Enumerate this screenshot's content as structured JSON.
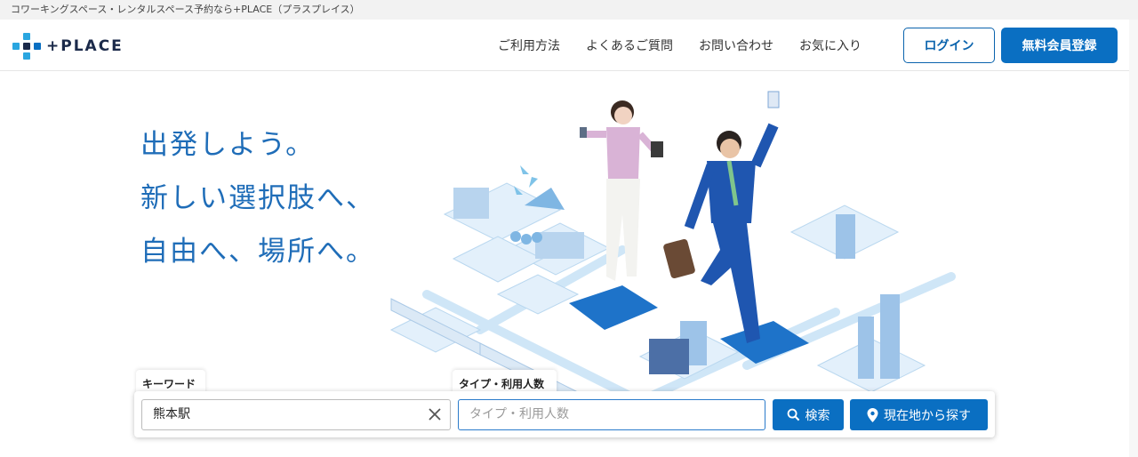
{
  "topbar": {
    "text": "コワーキングスペース・レンタルスペース予約なら+PLACE（プラスプレイス）"
  },
  "header": {
    "logo_text": "+PLACE",
    "nav": [
      "ご利用方法",
      "よくあるご質問",
      "お問い合わせ",
      "お気に入り"
    ],
    "login_label": "ログイン",
    "register_label": "無料会員登録"
  },
  "hero": {
    "catch": [
      "出発しよう。",
      "新しい選択肢へ、",
      "自由へ、場所へ。"
    ]
  },
  "search": {
    "keyword_tab": "キーワード",
    "keyword_value": "熊本駅",
    "type_tab": "タイプ・利用人数",
    "type_placeholder": "タイプ・利用人数",
    "search_label": "検索",
    "geo_label": "現在地から探す"
  },
  "colors": {
    "brand_blue": "#0a6fc2",
    "catch_blue": "#1f6db8",
    "logo_navy": "#1b2a4a"
  }
}
